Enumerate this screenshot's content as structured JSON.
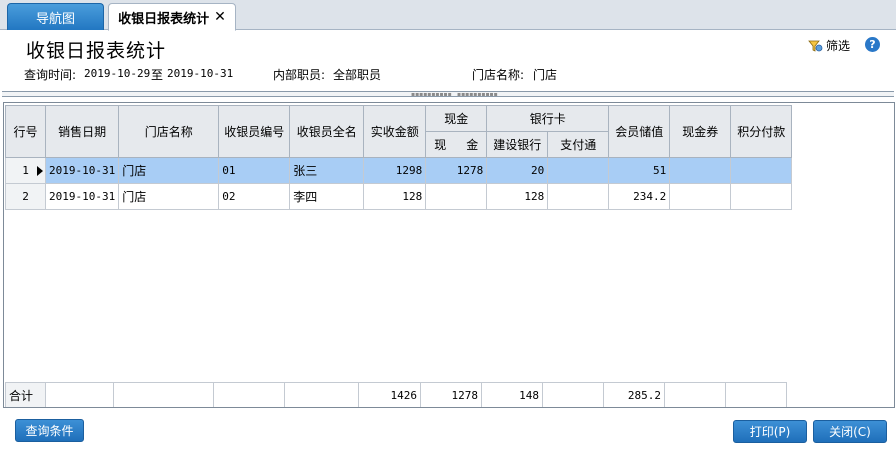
{
  "tabs": {
    "nav_label": "导航图",
    "active_label": "收银日报表统计",
    "close_glyph": "✕"
  },
  "header": {
    "title": "收银日报表统计",
    "filter_label": "筛选",
    "help_glyph": "?"
  },
  "meta": {
    "query_time_label": "查询时间:",
    "date_from": "2019-10-29",
    "to_label": "至",
    "date_to": "2019-10-31",
    "staff_label": "内部职员:",
    "staff_value": "全部职员",
    "store_label": "门店名称:",
    "store_value": "门店"
  },
  "grid": {
    "headers": {
      "row_no": "行号",
      "sale_date": "销售日期",
      "store_name": "门店名称",
      "cashier_code": "收银员编号",
      "cashier_name": "收银员全名",
      "amount": "实收金额",
      "cash_group": "现金",
      "cash_sub_1": "现",
      "cash_sub_2": "金",
      "bank_group": "银行卡",
      "bank_ccb": "建设银行",
      "bank_zft": "支付通",
      "member_value": "会员储值",
      "voucher": "现金券",
      "points_pay": "积分付款"
    },
    "rows": [
      {
        "row_no": "1",
        "sale_date": "2019-10-31",
        "store_name": "门店",
        "cashier_code": "01",
        "cashier_name": "张三",
        "amount": "1298",
        "cash": "1278",
        "bank_ccb": "20",
        "bank_zft": "",
        "member_value": "51",
        "voucher": "",
        "points_pay": ""
      },
      {
        "row_no": "2",
        "sale_date": "2019-10-31",
        "store_name": "门店",
        "cashier_code": "02",
        "cashier_name": "李四",
        "amount": "128",
        "cash": "",
        "bank_ccb": "128",
        "bank_zft": "",
        "member_value": "234.2",
        "voucher": "",
        "points_pay": ""
      }
    ],
    "totals": {
      "label": "合计",
      "amount": "1426",
      "cash": "1278",
      "bank_ccb": "148",
      "member_value": "285.2"
    }
  },
  "footer": {
    "query_button": "查询条件",
    "print_button": "打印(P)",
    "close_button": "关闭(C)"
  },
  "colors": {
    "accent": "#2277c2",
    "selected_row": "#a8cdf5"
  }
}
